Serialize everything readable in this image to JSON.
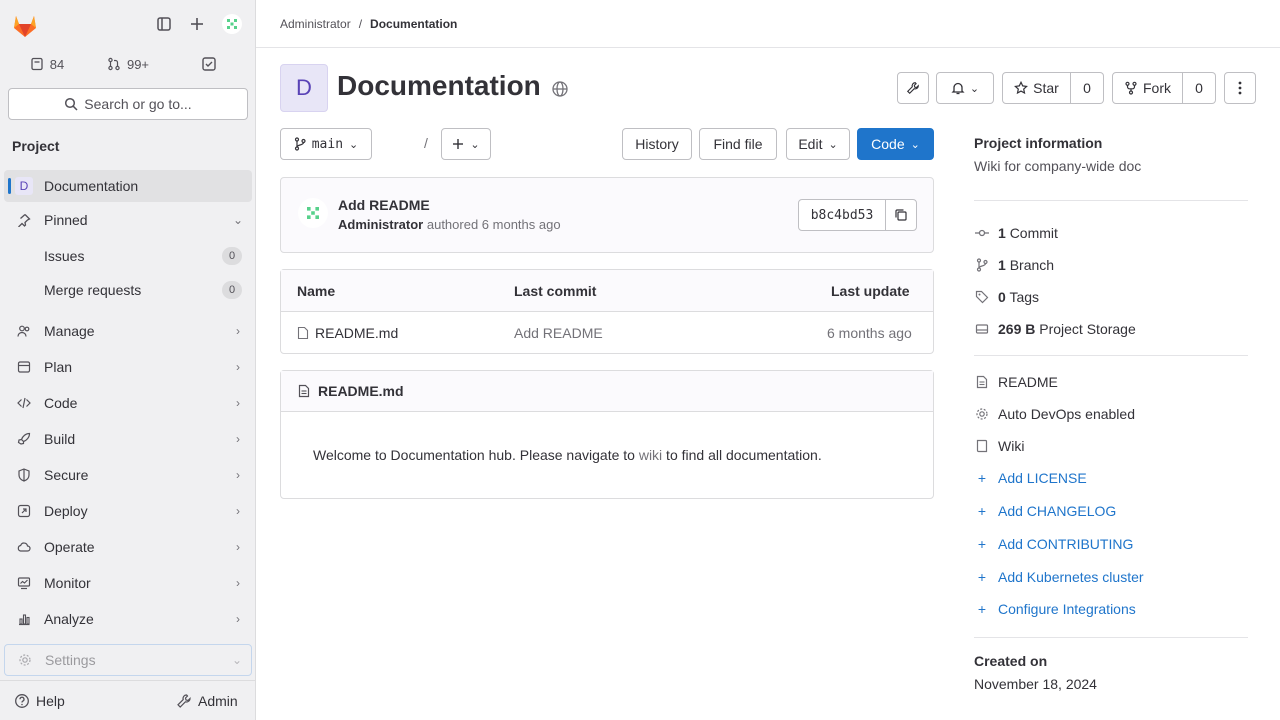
{
  "sidebar": {
    "counts": {
      "issues": "84",
      "merge_requests": "99+"
    },
    "search": {
      "label": "Search or go to..."
    },
    "section_title": "Project",
    "items": [
      {
        "label": "Documentation"
      },
      {
        "label": "Pinned"
      },
      {
        "label": "Issues",
        "badge": "0"
      },
      {
        "label": "Merge requests",
        "badge": "0"
      },
      {
        "label": "Manage"
      },
      {
        "label": "Plan"
      },
      {
        "label": "Code"
      },
      {
        "label": "Build"
      },
      {
        "label": "Secure"
      },
      {
        "label": "Deploy"
      },
      {
        "label": "Operate"
      },
      {
        "label": "Monitor"
      },
      {
        "label": "Analyze"
      },
      {
        "label": "Settings"
      }
    ],
    "project_avatar_letter": "D",
    "help_label": "Help",
    "admin_label": "Admin"
  },
  "breadcrumb": {
    "parent": "Administrator",
    "current": "Documentation"
  },
  "header": {
    "avatar_letter": "D",
    "title": "Documentation",
    "star_label": "Star",
    "star_count": "0",
    "fork_label": "Fork",
    "fork_count": "0"
  },
  "toolbar": {
    "branch": "main",
    "path_sep": "/",
    "history": "History",
    "find_file": "Find file",
    "edit": "Edit",
    "code": "Code"
  },
  "commit": {
    "title": "Add README",
    "author": "Administrator",
    "meta": "authored 6 months ago",
    "sha": "b8c4bd53"
  },
  "file_table": {
    "headers": [
      "Name",
      "Last commit",
      "Last update"
    ],
    "rows": [
      {
        "name": "README.md",
        "last_commit": "Add README",
        "last_update": "6 months ago"
      }
    ]
  },
  "readme": {
    "title": "README.md",
    "body_before": "Welcome to Documentation hub. Please navigate to ",
    "body_link": "wiki",
    "body_after": " to find all documentation."
  },
  "project_info": {
    "title": "Project information",
    "description": "Wiki for company-wide doc",
    "stats": [
      {
        "value": "1",
        "label": "Commit"
      },
      {
        "value": "1",
        "label": "Branch"
      },
      {
        "value": "0",
        "label": "Tags"
      },
      {
        "value": "269 B",
        "label": "Project Storage"
      }
    ],
    "links": [
      {
        "label": "README"
      },
      {
        "label": "Auto DevOps enabled"
      },
      {
        "label": "Wiki"
      }
    ],
    "adds": [
      {
        "label": "Add LICENSE"
      },
      {
        "label": "Add CHANGELOG"
      },
      {
        "label": "Add CONTRIBUTING"
      },
      {
        "label": "Add Kubernetes cluster"
      },
      {
        "label": "Configure Integrations"
      }
    ],
    "created_title": "Created on",
    "created_date": "November 18, 2024"
  },
  "colors": {
    "accent": "#1f75cb",
    "avatar_bg": "#e8e6f7",
    "avatar_fg": "#5943b6",
    "logo": "#e24329"
  }
}
